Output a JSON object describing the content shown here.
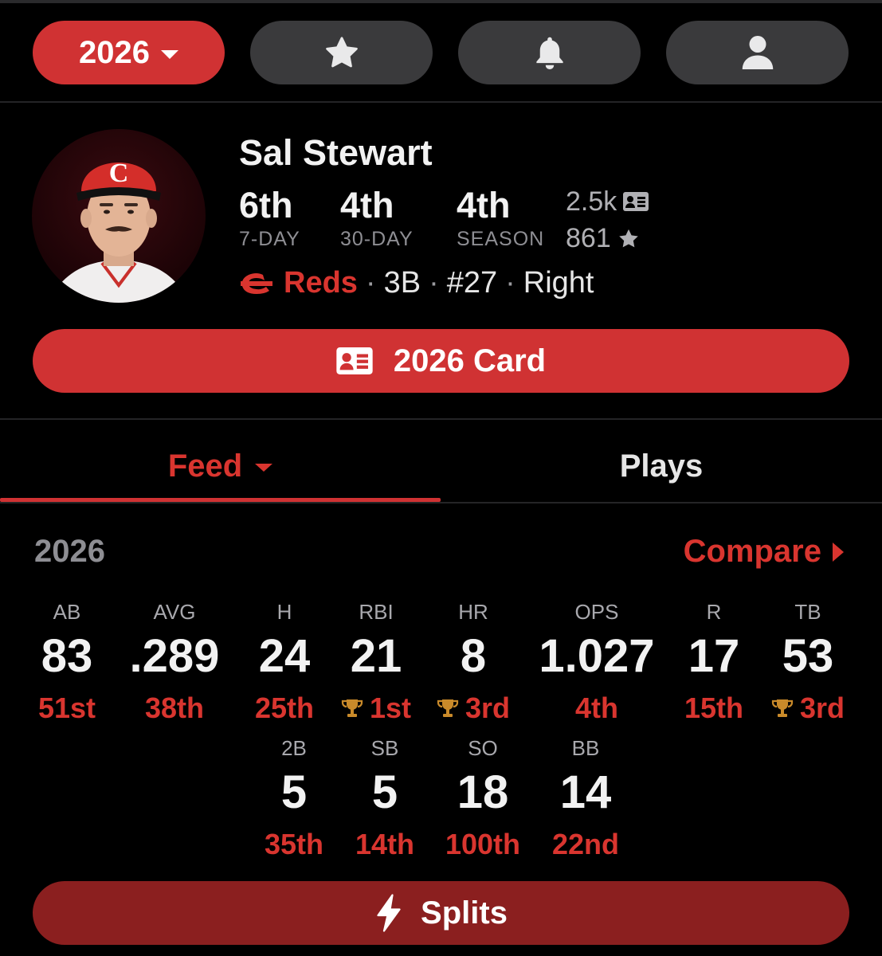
{
  "topnav": {
    "year_label": "2026",
    "icons": [
      "star-icon",
      "bell-icon",
      "user-icon"
    ]
  },
  "player": {
    "name": "Sal Stewart",
    "ranks": [
      {
        "value": "6th",
        "label": "7-DAY"
      },
      {
        "value": "4th",
        "label": "30-DAY"
      },
      {
        "value": "4th",
        "label": "SEASON"
      }
    ],
    "card_count": "2.5k",
    "star_count": "861",
    "team": "Reds",
    "position": "3B",
    "number": "#27",
    "bats": "Right"
  },
  "card_button": {
    "label": "2026 Card"
  },
  "tabs": {
    "feed": "Feed",
    "plays": "Plays"
  },
  "season": {
    "year": "2026",
    "compare_label": "Compare"
  },
  "stats_row1": [
    {
      "abbr": "AB",
      "value": "83",
      "rank": "51st",
      "trophy": false
    },
    {
      "abbr": "AVG",
      "value": ".289",
      "rank": "38th",
      "trophy": false
    },
    {
      "abbr": "H",
      "value": "24",
      "rank": "25th",
      "trophy": false
    },
    {
      "abbr": "RBI",
      "value": "21",
      "rank": "1st",
      "trophy": true
    },
    {
      "abbr": "HR",
      "value": "8",
      "rank": "3rd",
      "trophy": true
    },
    {
      "abbr": "OPS",
      "value": "1.027",
      "rank": "4th",
      "trophy": false
    },
    {
      "abbr": "R",
      "value": "17",
      "rank": "15th",
      "trophy": false
    },
    {
      "abbr": "TB",
      "value": "53",
      "rank": "3rd",
      "trophy": true
    }
  ],
  "stats_row2": [
    {
      "abbr": "2B",
      "value": "5",
      "rank": "35th",
      "trophy": false
    },
    {
      "abbr": "SB",
      "value": "5",
      "rank": "14th",
      "trophy": false
    },
    {
      "abbr": "SO",
      "value": "18",
      "rank": "100th",
      "trophy": false
    },
    {
      "abbr": "BB",
      "value": "14",
      "rank": "22nd",
      "trophy": false
    }
  ],
  "splits_button": {
    "label": "Splits"
  },
  "colors": {
    "accent": "#d03233",
    "accent_text": "#d9352f",
    "pill_gray": "#3a3a3c",
    "splits_bg": "#8b1f1f",
    "trophy": "#c98a2a",
    "background": "#000000"
  }
}
